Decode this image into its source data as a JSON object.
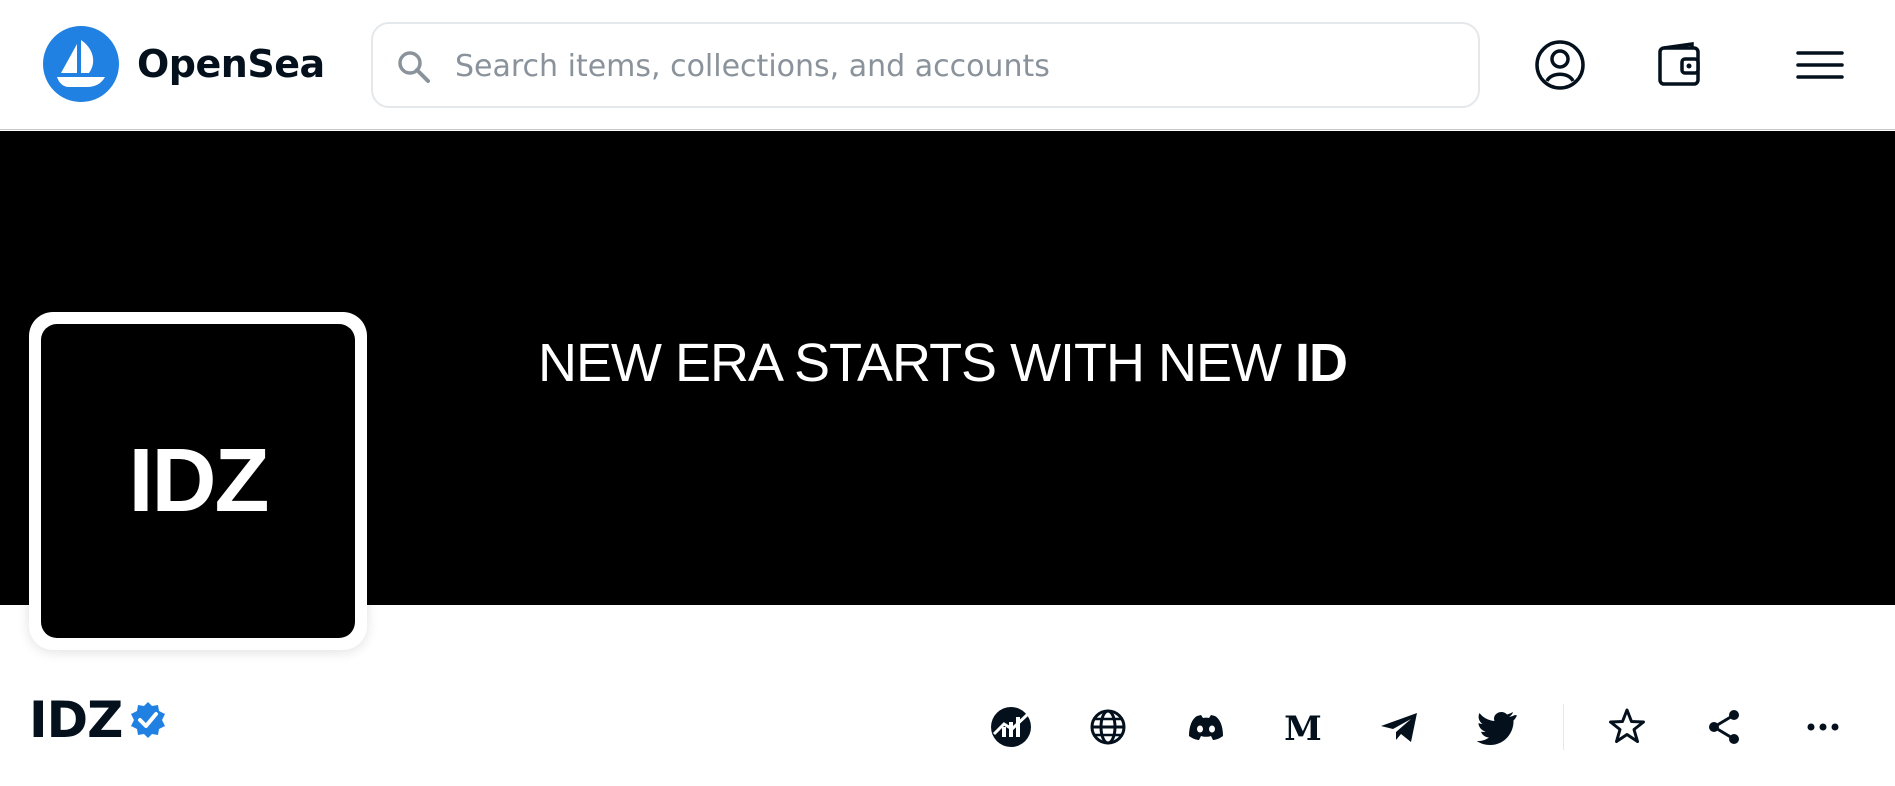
{
  "header": {
    "brand": "OpenSea",
    "search": {
      "placeholder": "Search items, collections, and accounts",
      "value": ""
    },
    "icons": [
      "user-account-icon",
      "wallet-icon",
      "menu-icon"
    ]
  },
  "banner": {
    "text_regular": "NEW ERA STARTS WITH NEW ",
    "text_bold": "ID",
    "background": "#000000"
  },
  "avatar": {
    "text": "IDZ"
  },
  "collection": {
    "name": "IDZ",
    "verified": true
  },
  "social_links": [
    "stats-icon",
    "website-icon",
    "discord-icon",
    "medium-icon",
    "telegram-icon",
    "twitter-icon"
  ],
  "actions": [
    "favorite-star-icon",
    "share-icon",
    "more-options-icon"
  ],
  "colors": {
    "accent": "#2081e2",
    "text": "#04111d",
    "placeholder": "#8a939b",
    "border": "#e5e8eb"
  }
}
